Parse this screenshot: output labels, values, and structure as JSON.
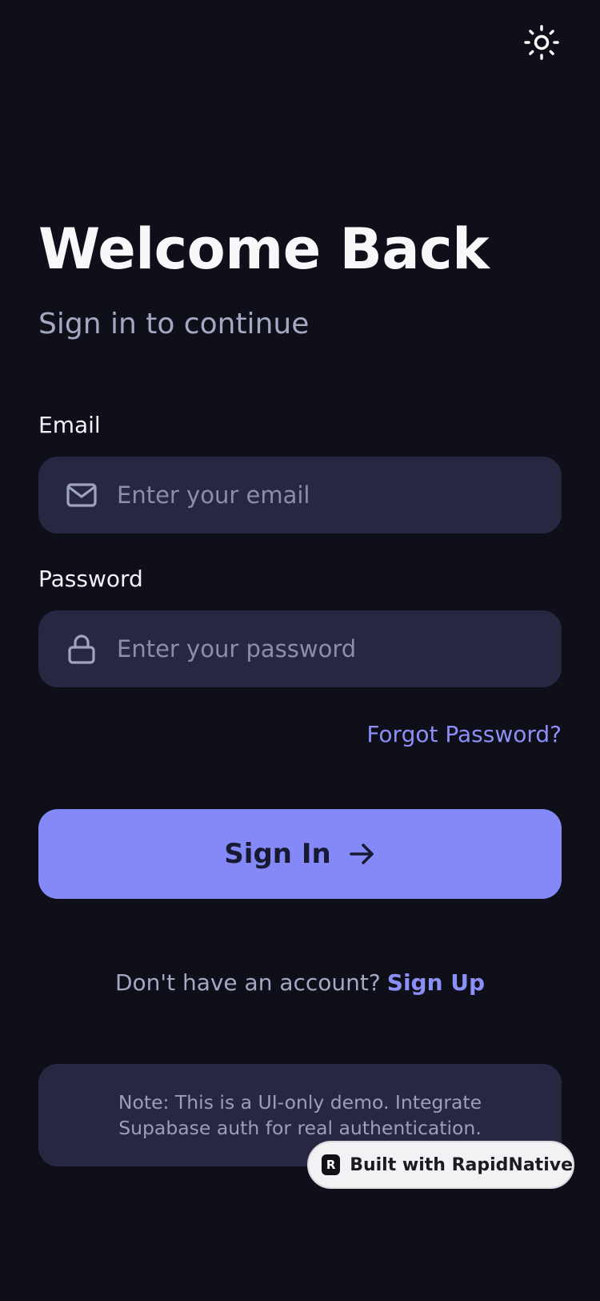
{
  "header": {
    "theme_toggle_icon": "sun-icon"
  },
  "hero": {
    "title": "Welcome Back",
    "subtitle": "Sign in to continue"
  },
  "form": {
    "email": {
      "label": "Email",
      "placeholder": "Enter your email",
      "value": "",
      "icon": "mail-icon"
    },
    "password": {
      "label": "Password",
      "placeholder": "Enter your password",
      "value": "",
      "icon": "lock-icon"
    },
    "forgot_label": "Forgot Password?",
    "submit_label": "Sign In",
    "submit_icon": "arrow-right-icon"
  },
  "signup": {
    "prompt": "Don't have an account?",
    "link_label": "Sign Up"
  },
  "note": {
    "text": "Note: This is a UI-only demo. Integrate Supabase auth for real authentication."
  },
  "badge": {
    "logo_letter": "R",
    "label": "Built with RapidNative"
  },
  "colors": {
    "background": "#0f0f1a",
    "surface": "#272742",
    "accent": "#8489f7",
    "link": "#8b8ff6",
    "muted_text": "#a3a8c3"
  }
}
